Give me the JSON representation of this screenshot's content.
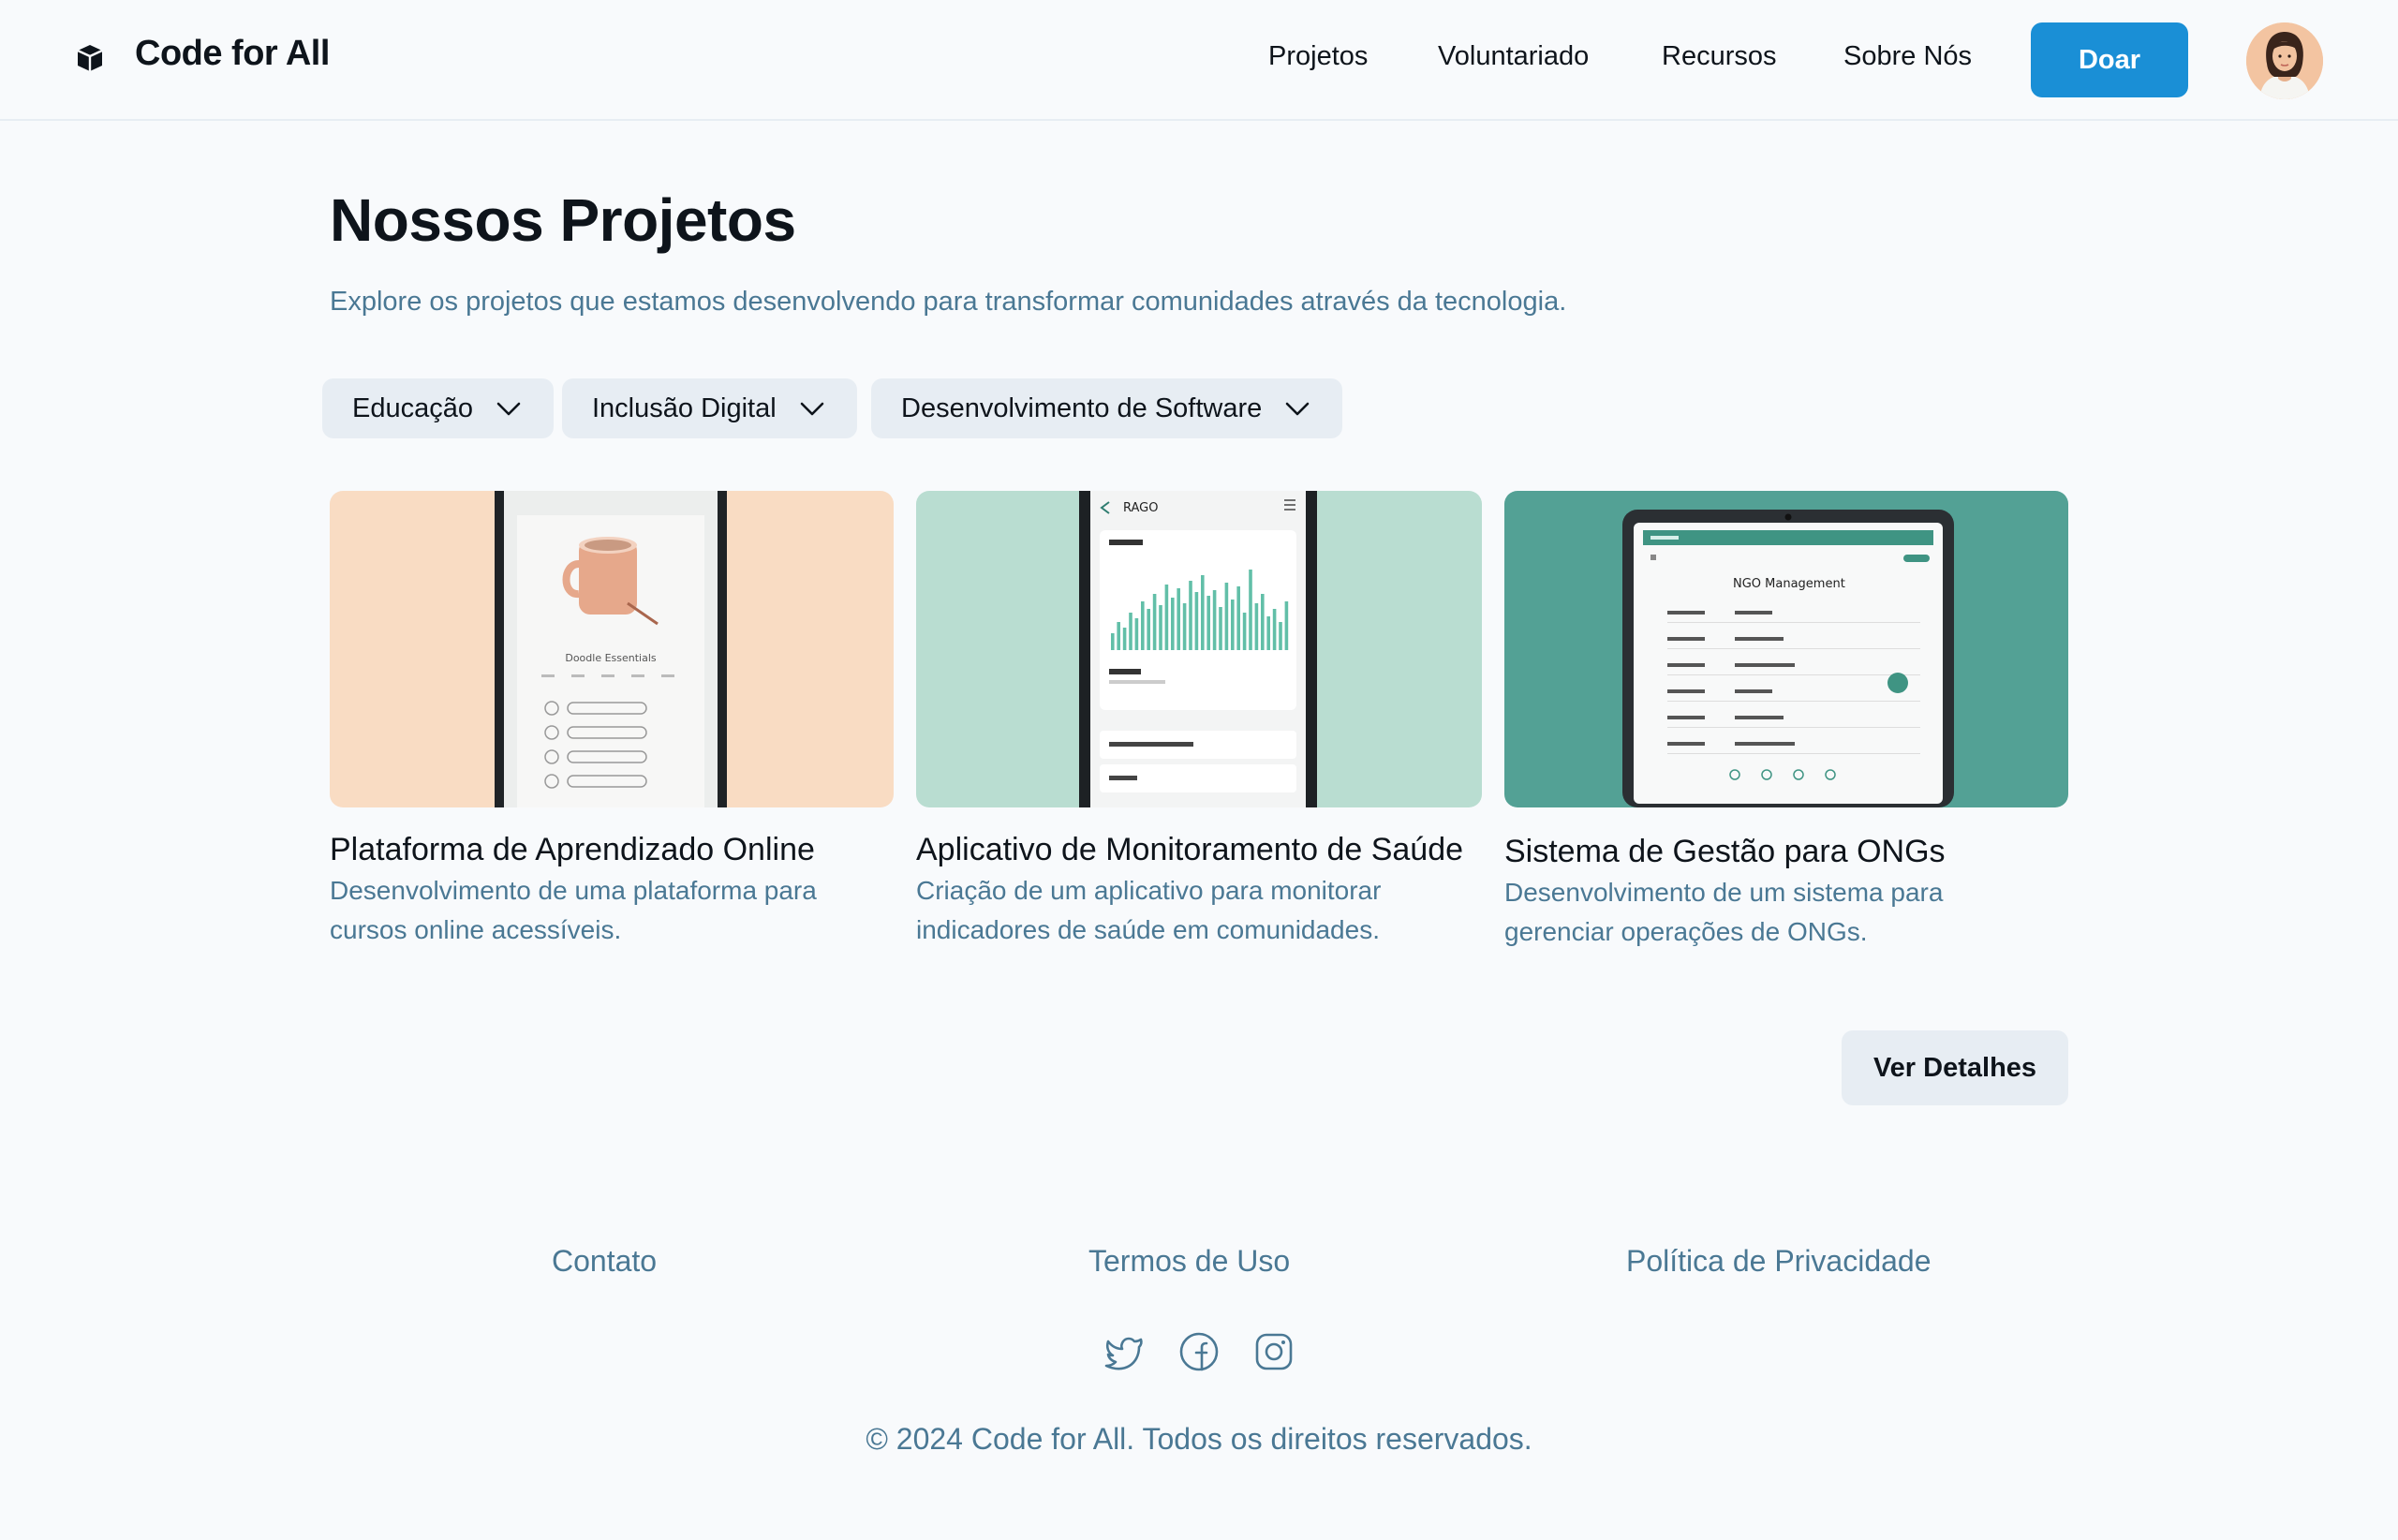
{
  "header": {
    "brand": "Code for All",
    "nav": [
      "Projetos",
      "Voluntariado",
      "Recursos",
      "Sobre Nós"
    ],
    "donate_label": "Doar"
  },
  "main": {
    "title": "Nossos Projetos",
    "subtitle": "Explore os projetos que estamos desenvolvendo para transformar comunidades através da tecnologia.",
    "filters": [
      "Educação",
      "Inclusão Digital",
      "Desenvolvimento de Software"
    ],
    "projects": [
      {
        "title": "Plataforma de Aprendizado Online",
        "description": "Desenvolvimento de uma plataforma para cursos online acessíveis.",
        "image_caption": "Doodle Essentials"
      },
      {
        "title": "Aplicativo de Monitoramento de Saúde",
        "description": "Criação de um aplicativo para monitorar indicadores de saúde em comunidades.",
        "image_caption": "RAGO"
      },
      {
        "title": "Sistema de Gestão para ONGs",
        "description": "Desenvolvimento de um sistema para gerenciar operações de ONGs.",
        "image_caption": "NGO Management"
      }
    ],
    "details_label": "Ver Detalhes"
  },
  "footer": {
    "links": [
      "Contato",
      "Termos de Uso",
      "Política de Privacidade"
    ],
    "social": [
      "twitter-icon",
      "facebook-icon",
      "instagram-icon"
    ],
    "copyright": "© 2024 Code for All. Todos os direitos reservados."
  },
  "colors": {
    "accent": "#1a8fd6",
    "muted_text": "#4a7894",
    "chip_bg": "#e7edf3",
    "card1_bg": "#f9dcc3",
    "card2_bg": "#b9ddd1",
    "card3_bg": "#53a195"
  }
}
